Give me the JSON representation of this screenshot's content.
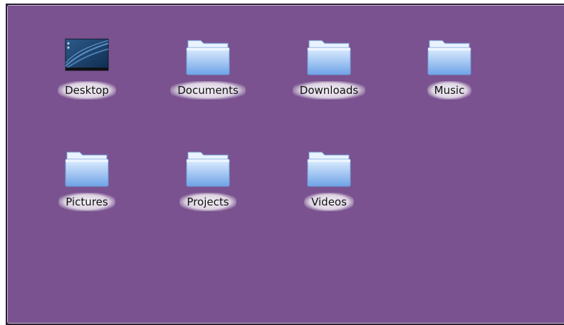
{
  "desktop": {
    "items": [
      {
        "label": "Desktop",
        "icon": "desktop-thumbnail-icon"
      },
      {
        "label": "Documents",
        "icon": "folder-icon"
      },
      {
        "label": "Downloads",
        "icon": "folder-icon"
      },
      {
        "label": "Music",
        "icon": "folder-icon"
      },
      {
        "label": "Pictures",
        "icon": "folder-icon"
      },
      {
        "label": "Projects",
        "icon": "folder-icon"
      },
      {
        "label": "Videos",
        "icon": "folder-icon"
      }
    ]
  },
  "colors": {
    "background": "#79528f",
    "folder_light": "#cfe3ff",
    "folder_dark": "#6fa3e6"
  }
}
